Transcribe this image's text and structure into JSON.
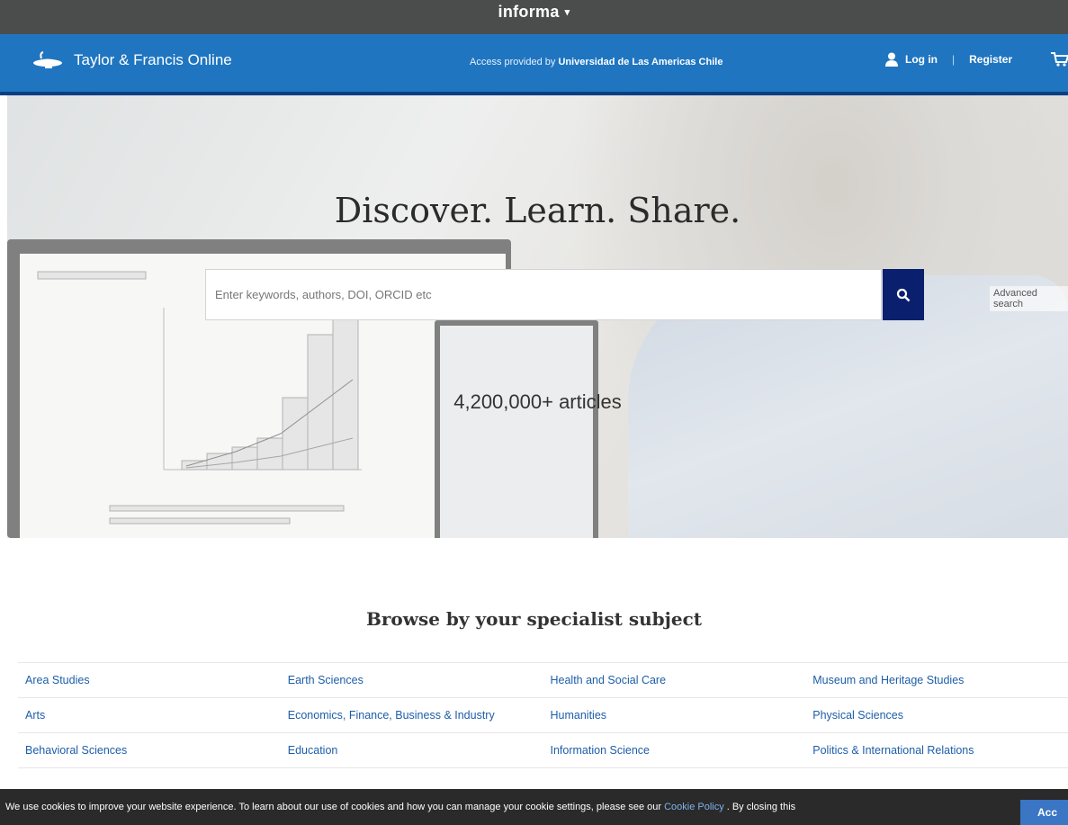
{
  "informa": {
    "brand": "informa",
    "caret": "▾"
  },
  "header": {
    "site_name": "Taylor & Francis Online",
    "access_prefix": "Access provided by",
    "access_org": "Universidad de Las Americas Chile",
    "login_label": "Log in",
    "separator": "|",
    "register_label": "Register",
    "cart_icon": "cart-icon",
    "user_icon": "user-icon",
    "colors": {
      "header_bg": "#1f75c0",
      "informa_bg": "#4a4d4b",
      "search_button": "#0a1f6e"
    }
  },
  "hero": {
    "tagline": "Discover. Learn. Share.",
    "search_placeholder": "Enter keywords, authors, DOI, ORCID etc",
    "search_icon": "search-icon",
    "advanced_search": "Advanced search",
    "article_count": "4,200,000+ articles"
  },
  "browse": {
    "title": "Browse by your specialist subject",
    "rows": [
      [
        "Area Studies",
        "Earth Sciences",
        "Health and Social Care",
        "Museum and Heritage Studies"
      ],
      [
        "Arts",
        "Economics, Finance, Business & Industry",
        "Humanities",
        "Physical Sciences"
      ],
      [
        "Behavioral Sciences",
        "Education",
        "Information Science",
        "Politics & International Relations"
      ]
    ]
  },
  "cookie": {
    "text_before": "We use cookies to improve your website experience. To learn about our use of cookies and how you can manage your cookie settings, please see our",
    "policy_link": "Cookie Policy",
    "text_after": ". By closing this",
    "accept_label": "Acc"
  }
}
